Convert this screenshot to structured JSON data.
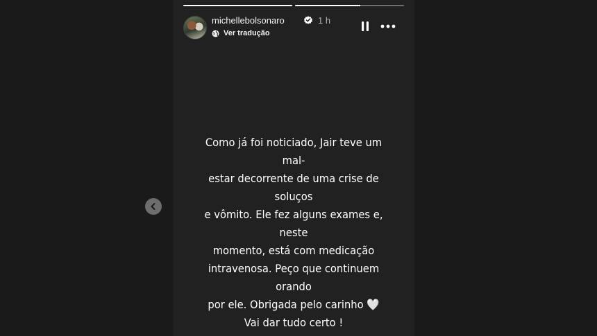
{
  "story": {
    "progress": [
      1.0,
      0.6
    ],
    "username": "michellebolsonaro",
    "time_ago": "1 h",
    "translate_label": "Ver tradução",
    "text": "Como já foi noticiado, Jair teve um mal-\nestar decorrente de uma crise de soluços\ne vômito. Ele fez alguns exames e, neste\nmomento, está com medicação\nintravenosa. Peço que continuem orando\npor ele. Obrigada pelo carinho 🤍\nVai dar tudo certo !"
  },
  "icons": {
    "verified": "verified-badge-icon",
    "translate": "translate-globe-icon",
    "pause": "pause-icon",
    "more": "more-options-icon",
    "prev": "chevron-left-icon"
  },
  "colors": {
    "page_background": "#1a1a1a",
    "story_background": "#212121",
    "verified_badge": "#ffffff",
    "nav_button": "#6d6d6d"
  }
}
